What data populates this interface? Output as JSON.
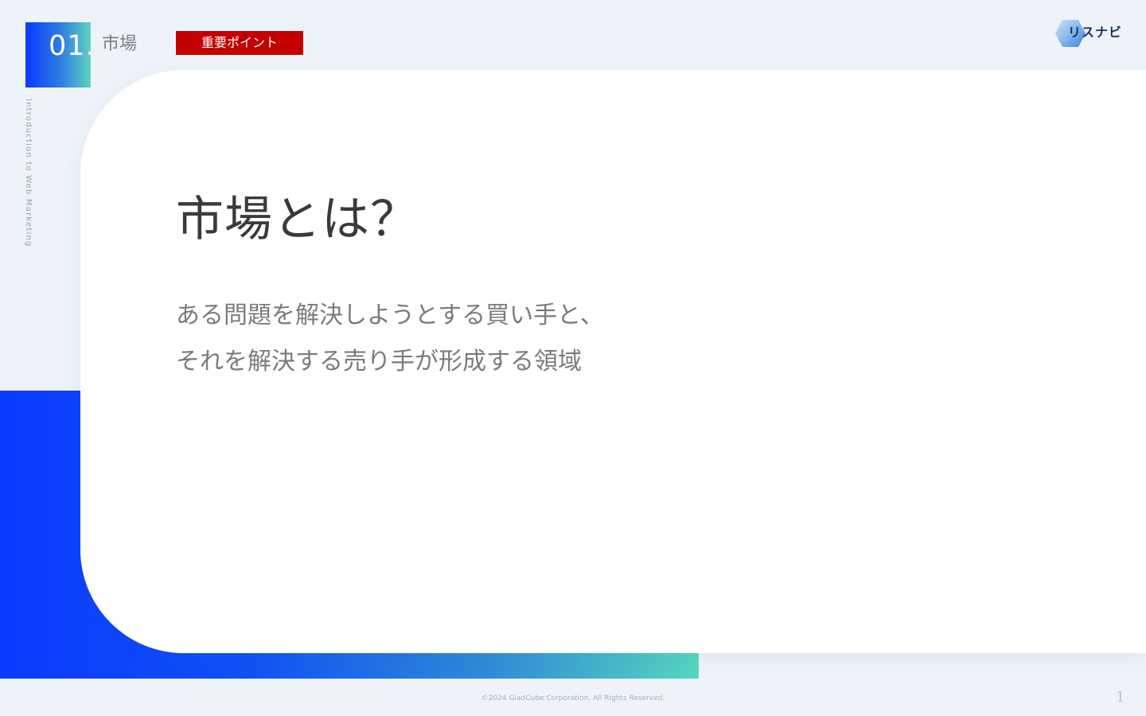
{
  "header": {
    "section_number": "01.",
    "section_title": "市場",
    "important_tag": "重要ポイント",
    "vertical_subtitle": "Introduction to Web Marketing"
  },
  "logo": {
    "text": "リスナビ",
    "colors": {
      "hex_light": "#cfe4fb",
      "hex_mid": "#7fb3ea",
      "hex_dark": "#3f7fd6",
      "text": "#1b2f5e"
    }
  },
  "slide": {
    "heading": "市場とは？",
    "definition_lines": [
      "ある問題を解決しようとする買い手と、",
      "それを解決する売り手が形成する領域"
    ]
  },
  "footer": {
    "copyright": "©2024 GladCube Corporation. All Rights Reserved.",
    "page_number": "1"
  },
  "colors": {
    "accent_blue": "#0a3bff",
    "accent_teal": "#56d7bf",
    "tag_red": "#c40000",
    "background": "#eef3fa"
  }
}
